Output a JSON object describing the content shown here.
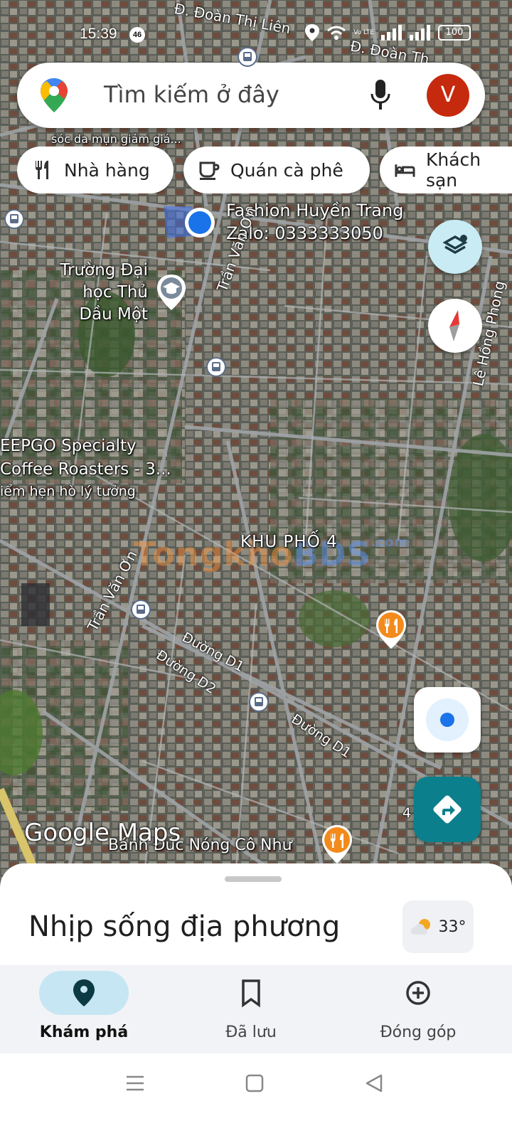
{
  "status_bar": {
    "time": "15:39",
    "notification_count": "46",
    "network_label": "Vo LTE",
    "battery": "100"
  },
  "search": {
    "placeholder": "Tìm kiếm ở đây",
    "avatar_letter": "V",
    "avatar_color": "#c62a0e"
  },
  "chips": [
    {
      "label": "Nhà hàng",
      "icon": "restaurant-icon"
    },
    {
      "label": "Quán cà phê",
      "icon": "coffee-icon"
    },
    {
      "label": "Khách sạn",
      "icon": "hotel-icon"
    }
  ],
  "map": {
    "type": "satellite",
    "streets": {
      "doan_thi_lien_1": "Đ. Đoàn Thị Liên",
      "doan_thi_lien_2": "Đ. Đoàn Th",
      "tran_van_on_north": "Trần Văn Ơn",
      "tran_van_on_south": "Trần Văn Ơn",
      "le_hong_phong": "Lê Hồng Phong",
      "duong_d1_a": "Đường D1",
      "duong_d2": "Đường D2",
      "duong_d1_b": "Đường D1",
      "fragment_4": "4"
    },
    "places": {
      "fashion_name": "Fashion Huyền Trang",
      "fashion_zalo": "Zalo: 0333333050",
      "university": [
        "Trường Đại",
        "học Thủ",
        "Dầu Một"
      ],
      "cafe_line1": "EEPGO Specialty",
      "cafe_line2": "Coffee Roasters - 3...",
      "cafe_line3": "iểm hẹn hò lý tưởng",
      "area": "KHU PHỐ 4",
      "banh": "Bánh Đúc Nóng Cô Như",
      "top_snippet": "sóc da mụn giảm giá..."
    },
    "attribution": "Google Maps",
    "watermark_a": "Tongkho",
    "watermark_b": "BDS",
    "watermark_c": ".com",
    "colors": {
      "my_location": "#1a73e8",
      "food_poi": "#f28b1c",
      "directions_button": "#0c7f8c",
      "layers_button": "#c9ebf3"
    }
  },
  "sheet": {
    "title": "Nhịp sống địa phương",
    "temperature": "33°",
    "weather_icon": "partly-sunny-icon"
  },
  "bottom_nav": [
    {
      "label": "Khám phá",
      "icon": "explore-pin-icon",
      "active": true
    },
    {
      "label": "Đã lưu",
      "icon": "bookmark-icon",
      "active": false
    },
    {
      "label": "Đóng góp",
      "icon": "add-circle-icon",
      "active": false
    }
  ]
}
